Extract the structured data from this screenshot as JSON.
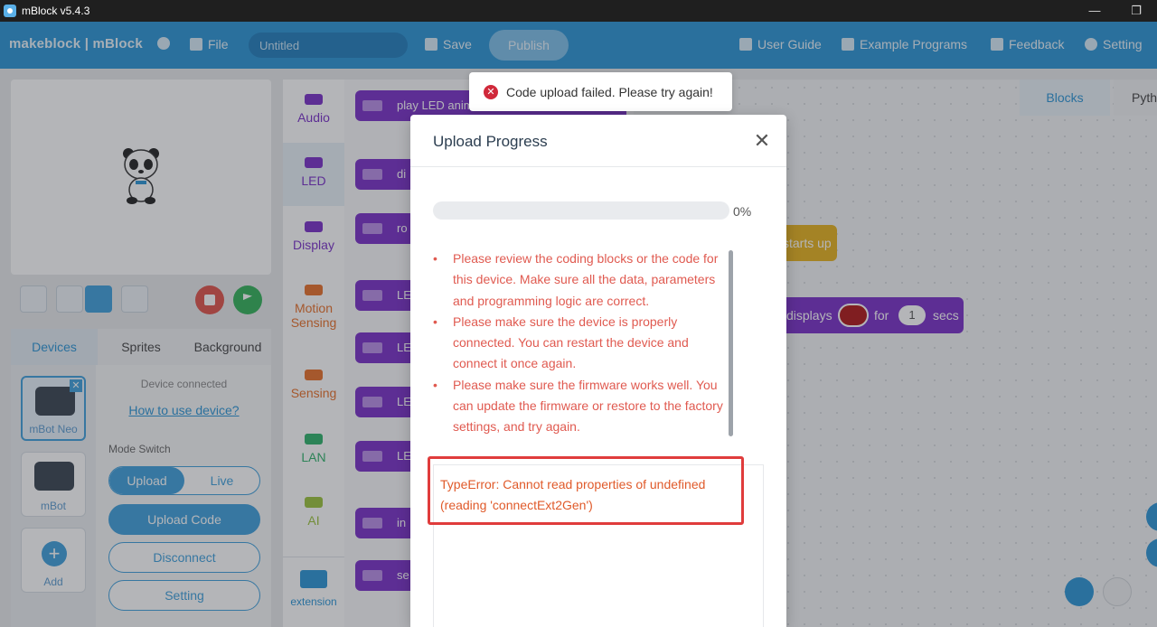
{
  "window": {
    "title": "mBlock v5.4.3"
  },
  "menubar": {
    "logo": "makeblock | mBlock",
    "file": "File",
    "project_title": "Untitled",
    "save": "Save",
    "publish": "Publish",
    "user_guide": "User Guide",
    "example_programs": "Example Programs",
    "feedback": "Feedback",
    "setting": "Setting"
  },
  "stage_tabs": [
    "Devices",
    "Sprites",
    "Background"
  ],
  "devices": {
    "items": [
      {
        "label": "mBot Neo",
        "selected": true
      },
      {
        "label": "mBot",
        "selected": false
      }
    ],
    "add_label": "Add",
    "status": "Device connected",
    "how_to": "How to use device?",
    "mode_switch_label": "Mode Switch",
    "mode_options": [
      "Upload",
      "Live"
    ],
    "upload_code": "Upload Code",
    "disconnect": "Disconnect",
    "setting": "Setting"
  },
  "categories": [
    {
      "label": "Audio",
      "color": "#7a31c8"
    },
    {
      "label": "LED",
      "color": "#7a31c8"
    },
    {
      "label": "Display",
      "color": "#7a31c8"
    },
    {
      "label": "Motion Sensing",
      "color": "#e8702a"
    },
    {
      "label": "Sensing",
      "color": "#e8702a"
    },
    {
      "label": "LAN",
      "color": "#2fb36b"
    },
    {
      "label": "AI",
      "color": "#9bc33c"
    }
  ],
  "extension_label": "extension",
  "palette_blocks": [
    "play LED animation  rainbow ▾  until done",
    "di",
    "ro",
    "LE",
    "LE",
    "LE",
    "LE",
    "in",
    "se"
  ],
  "workspace": {
    "tabs": [
      "Blocks",
      "Pyth"
    ],
    "hat_block": "starts up",
    "cmd_block": {
      "label1": "displays",
      "label2": "for",
      "value": "1",
      "label3": "secs"
    }
  },
  "toast": {
    "message": "Code upload failed. Please try again!"
  },
  "modal": {
    "title": "Upload Progress",
    "progress": 0,
    "progress_text": "0%",
    "tips": [
      "Please review the coding blocks or the code for this device. Make sure all the data, parameters and programming logic are correct.",
      "Please make sure the device is properly connected. You can restart the device and connect it once again.",
      "Please make sure the firmware works well. You can update the firmware or restore to the factory settings, and try again."
    ],
    "error": "TypeError: Cannot read properties of undefined (reading 'connectExt2Gen')"
  },
  "colors": {
    "accent": "#2b95d6",
    "error_text": "#e05a50",
    "error_border": "#e03c3c",
    "block_purple": "#7a31c8",
    "event_yellow": "#e6b31e"
  }
}
